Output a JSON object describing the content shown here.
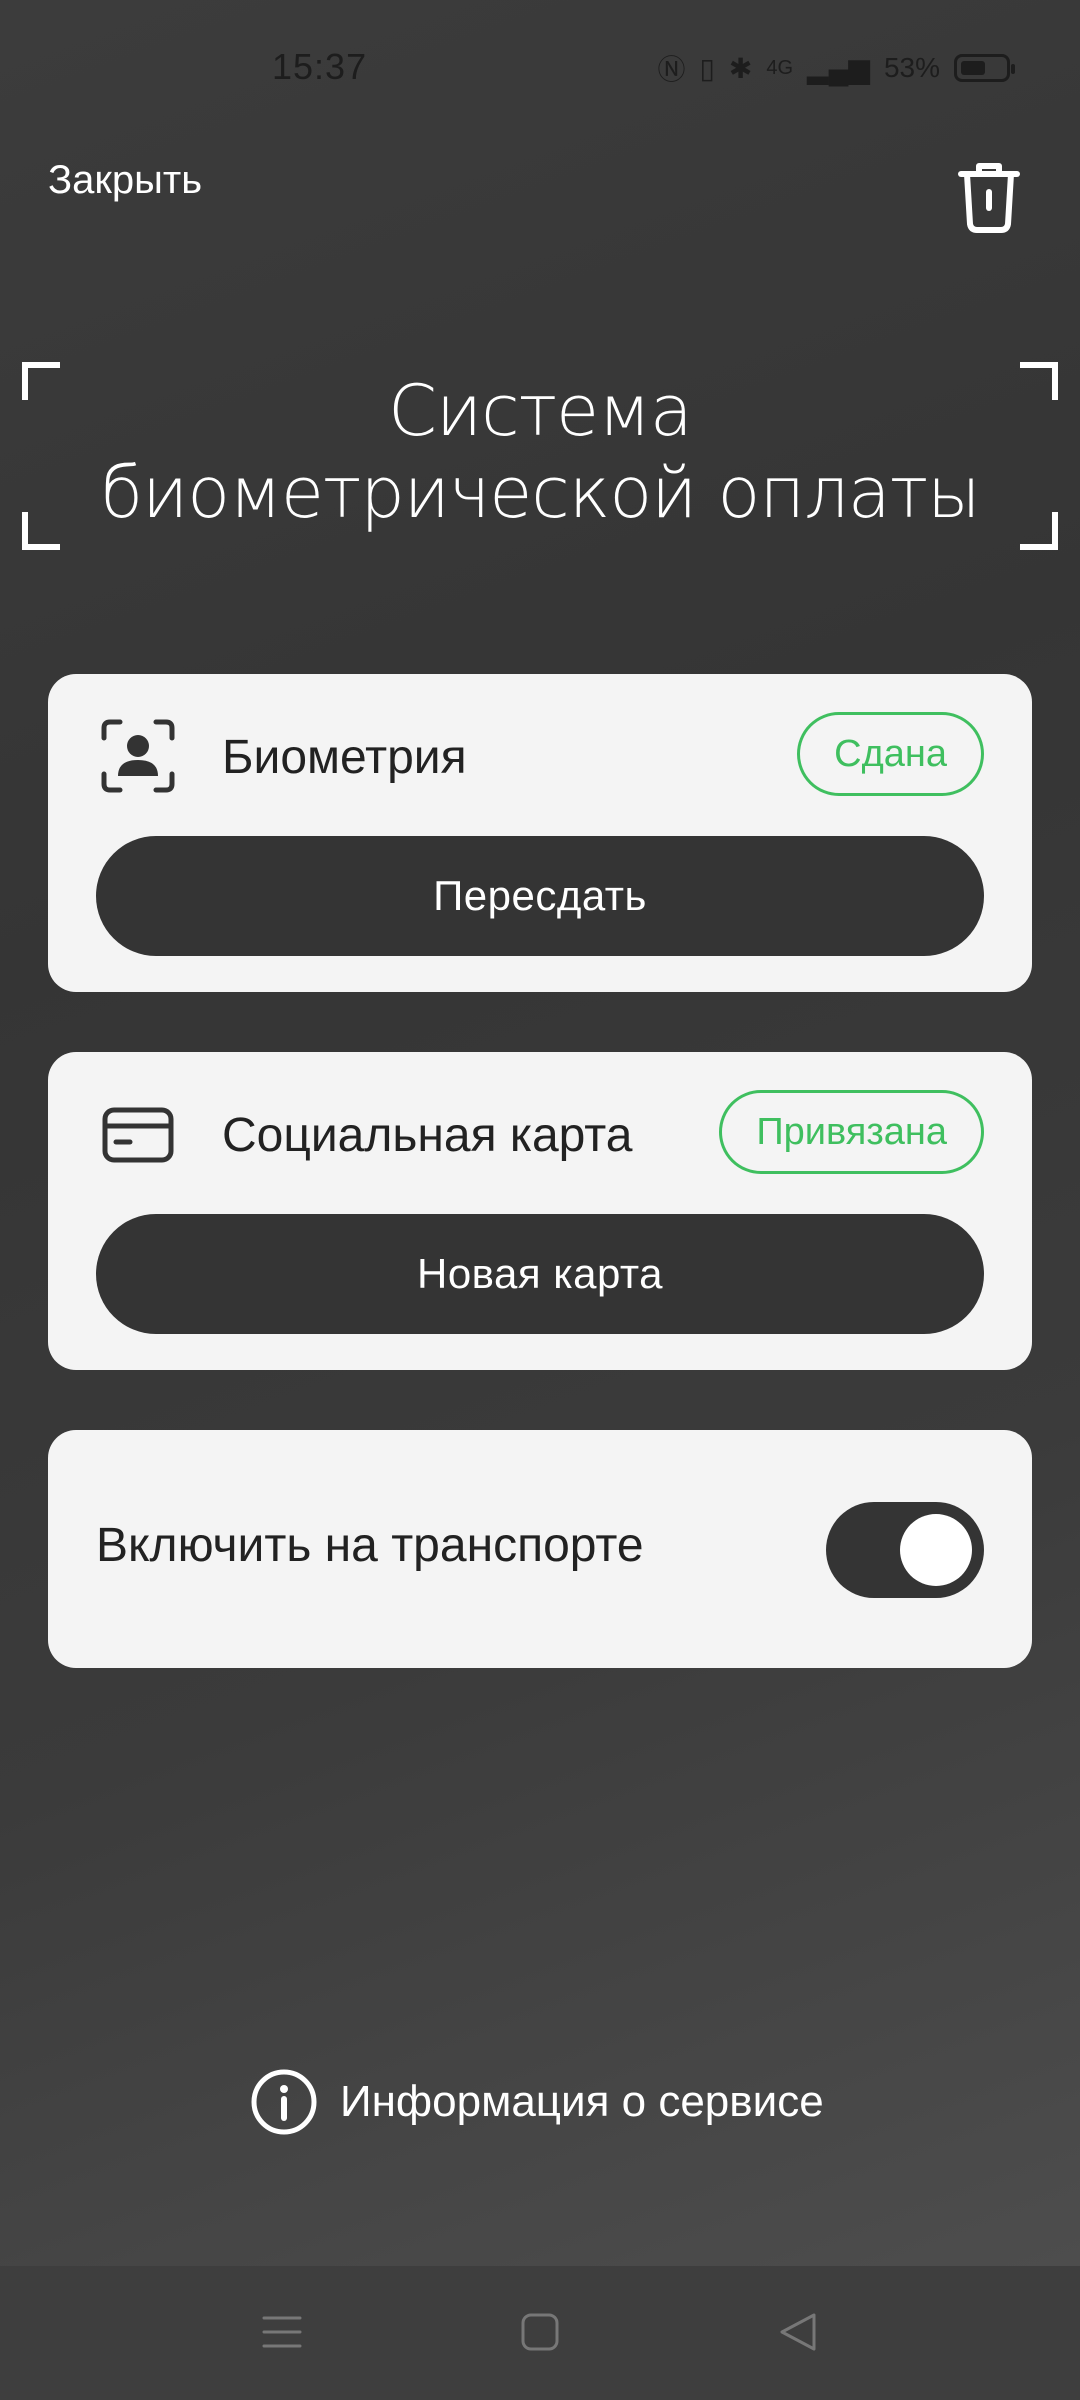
{
  "status_bar": {
    "time": "15:37",
    "battery": "53%",
    "network": "4G"
  },
  "header": {
    "close_label": "Закрыть"
  },
  "title": {
    "line1": "Система",
    "line2": "биометрической оплаты"
  },
  "cards": {
    "biometry": {
      "label": "Биометрия",
      "status": "Сдана",
      "button": "Пересдать"
    },
    "social_card": {
      "label": "Социальная карта",
      "status": "Привязана",
      "button": "Новая карта"
    },
    "transport": {
      "label": "Включить на транспорте",
      "enabled": true
    }
  },
  "footer": {
    "info_label": "Информация о сервисе"
  },
  "colors": {
    "accent_green": "#3fbf5f",
    "dark_button": "#343434",
    "card_bg": "#f4f4f4"
  },
  "icons": [
    "face-id-icon",
    "card-icon",
    "trash-icon",
    "info-icon",
    "menu-icon",
    "home-icon",
    "back-icon"
  ]
}
